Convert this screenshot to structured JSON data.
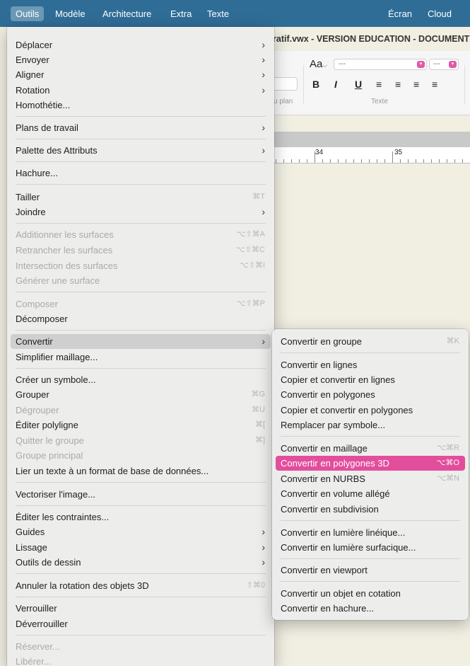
{
  "menubar": {
    "items": [
      "Outils",
      "Modèle",
      "Architecture",
      "Extra",
      "Texte",
      "Écran",
      "Cloud"
    ]
  },
  "window": {
    "title": "ratif.vwx - VERSION EDUCATION - DOCUMENT",
    "toolbar": {
      "font_button": "Aa",
      "font_placeholder": "---",
      "size_placeholder": "---",
      "bold": "B",
      "italic": "I",
      "underline": "U",
      "align_left": "≡",
      "align_center": "≡",
      "align_right": "≡",
      "align_justify": "≡",
      "caption_left": "u plan",
      "caption_text": "Texte"
    },
    "ruler": [
      "34",
      "35"
    ]
  },
  "main_menu": {
    "items": [
      {
        "label": "Déplacer",
        "submenu": true
      },
      {
        "label": "Envoyer",
        "submenu": true
      },
      {
        "label": "Aligner",
        "submenu": true
      },
      {
        "label": "Rotation",
        "submenu": true
      },
      {
        "label": "Homothétie..."
      },
      {
        "label": "Plans de travail",
        "submenu": true
      },
      {
        "label": "Palette des Attributs",
        "submenu": true
      },
      {
        "label": "Hachure..."
      },
      {
        "label": "Tailler",
        "shortcut": "⌘T"
      },
      {
        "label": "Joindre",
        "submenu": true
      },
      {
        "label": "Additionner les surfaces",
        "shortcut": "⌥⇧⌘A",
        "disabled": true
      },
      {
        "label": "Retrancher les surfaces",
        "shortcut": "⌥⇧⌘C",
        "disabled": true
      },
      {
        "label": "Intersection des surfaces",
        "shortcut": "⌥⇧⌘I",
        "disabled": true
      },
      {
        "label": "Générer une surface",
        "disabled": true
      },
      {
        "label": "Composer",
        "shortcut": "⌥⇧⌘P",
        "disabled": true
      },
      {
        "label": "Décomposer"
      },
      {
        "label": "Convertir",
        "submenu": true,
        "open": true
      },
      {
        "label": "Simplifier maillage..."
      },
      {
        "label": "Créer un symbole..."
      },
      {
        "label": "Grouper",
        "shortcut": "⌘G"
      },
      {
        "label": "Dégrouper",
        "shortcut": "⌘U",
        "disabled": true
      },
      {
        "label": "Éditer polyligne",
        "shortcut": "⌘["
      },
      {
        "label": "Quitter le groupe",
        "shortcut": "⌘]",
        "disabled": true
      },
      {
        "label": "Groupe principal",
        "disabled": true
      },
      {
        "label": "Lier un texte à un format de base de données..."
      },
      {
        "label": "Vectoriser l'image..."
      },
      {
        "label": "Éditer les contraintes..."
      },
      {
        "label": "Guides",
        "submenu": true
      },
      {
        "label": "Lissage",
        "submenu": true
      },
      {
        "label": "Outils de dessin",
        "submenu": true
      },
      {
        "label": "Annuler la rotation des objets 3D",
        "shortcut": "⇧⌘0"
      },
      {
        "label": "Verrouiller"
      },
      {
        "label": "Déverrouiller"
      },
      {
        "label": "Réserver...",
        "disabled": true
      },
      {
        "label": "Libérer...",
        "disabled": true
      }
    ]
  },
  "convert_submenu": {
    "items": [
      {
        "label": "Convertir en groupe",
        "shortcut": "⌘K"
      },
      {
        "label": "Convertir en lignes"
      },
      {
        "label": "Copier et convertir en lignes"
      },
      {
        "label": "Convertir en polygones"
      },
      {
        "label": "Copier et convertir en polygones"
      },
      {
        "label": "Remplacer par symbole..."
      },
      {
        "label": "Convertir en maillage",
        "shortcut": "⌥⌘R"
      },
      {
        "label": "Convertir en polygones 3D",
        "shortcut": "⌥⌘O",
        "highlighted": true
      },
      {
        "label": "Convertir en NURBS",
        "shortcut": "⌥⌘N"
      },
      {
        "label": "Convertir en volume allégé"
      },
      {
        "label": "Convertir en subdivision"
      },
      {
        "label": "Convertir en lumière linéique..."
      },
      {
        "label": "Convertir en lumière surfacique..."
      },
      {
        "label": "Convertir en viewport"
      },
      {
        "label": "Convertir un objet en cotation"
      },
      {
        "label": "Convertir en hachure..."
      }
    ]
  },
  "colors": {
    "menubar": "#2f6d97",
    "highlight": "#e24e9c",
    "canvas": "#f1efe2"
  }
}
